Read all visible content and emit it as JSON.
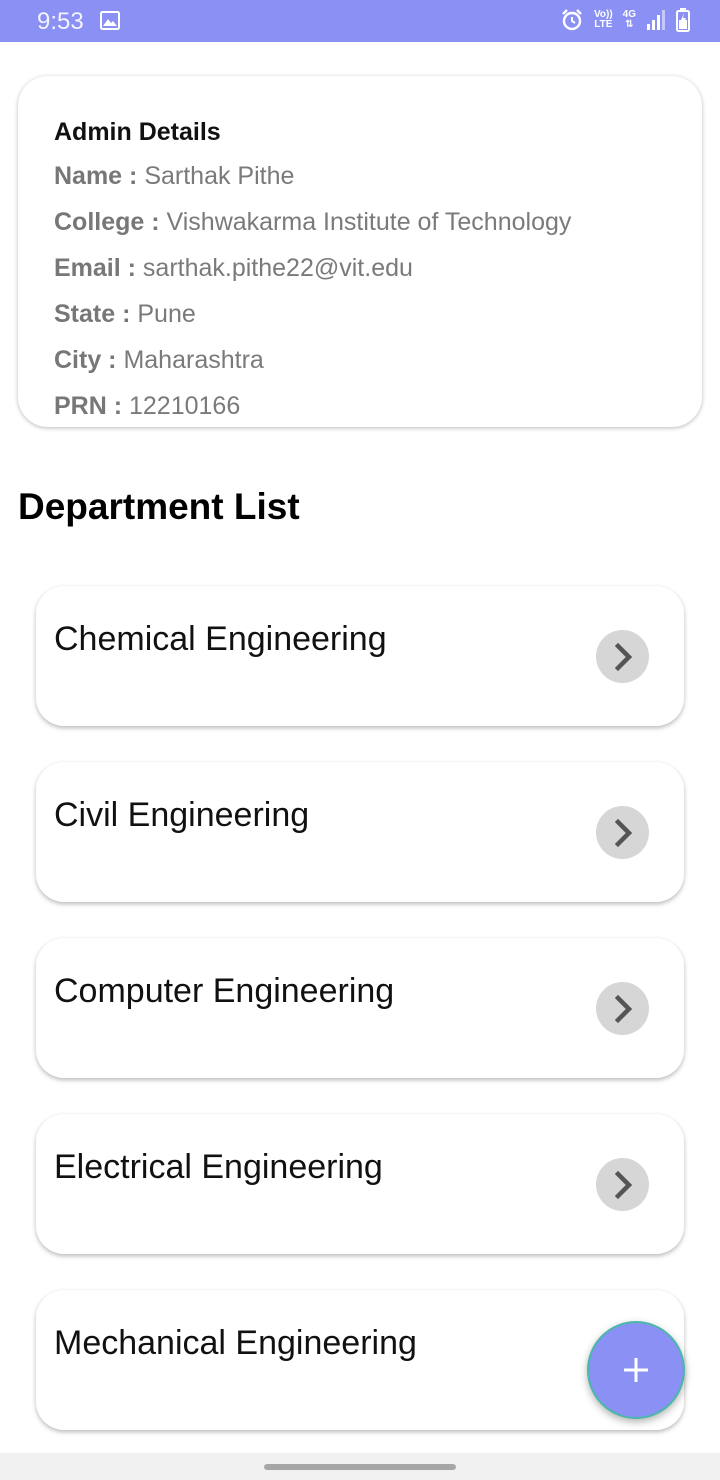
{
  "status_bar": {
    "time": "9:53",
    "icons": [
      "gallery-icon",
      "alarm-icon",
      "volte-icon",
      "4g-icon",
      "signal-icon",
      "battery-icon"
    ],
    "volte_top": "Vo))",
    "volte_bottom": "LTE",
    "net_label": "4G",
    "color": "#8a90f4"
  },
  "admin": {
    "title": "Admin Details",
    "rows": [
      {
        "key": "Name : ",
        "value": "Sarthak Pithe"
      },
      {
        "key": "College : ",
        "value": "Vishwakarma Institute of Technology"
      },
      {
        "key": "Email : ",
        "value": "sarthak.pithe22@vit.edu"
      },
      {
        "key": "State : ",
        "value": "Pune"
      },
      {
        "key": "City : ",
        "value": "Maharashtra"
      },
      {
        "key": "PRN : ",
        "value": "12210166"
      }
    ]
  },
  "departments": {
    "heading": "Department List",
    "items": [
      {
        "name": "Chemical Engineering",
        "icon": "chevron-right-icon"
      },
      {
        "name": "Civil Engineering",
        "icon": "chevron-right-icon"
      },
      {
        "name": "Computer Engineering",
        "icon": "chevron-right-icon"
      },
      {
        "name": "Electrical Engineering",
        "icon": "chevron-right-icon"
      },
      {
        "name": "Mechanical Engineering",
        "icon": "chevron-right-icon"
      }
    ]
  },
  "fab": {
    "icon": "plus-icon",
    "color": "#8a90f4"
  }
}
